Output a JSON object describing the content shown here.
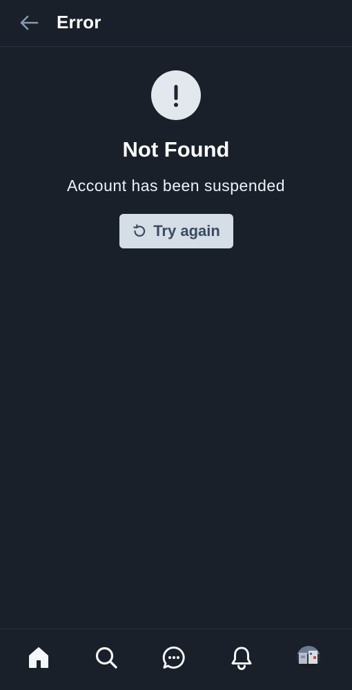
{
  "header": {
    "title": "Error",
    "back_icon": "arrow-left-icon"
  },
  "error": {
    "icon": "exclamation-icon",
    "title": "Not Found",
    "message": "Account has been suspended",
    "retry_label": "Try again",
    "retry_icon": "refresh-icon"
  },
  "bottom_nav": {
    "items": [
      {
        "name": "home",
        "icon": "home-icon",
        "active": true
      },
      {
        "name": "search",
        "icon": "search-icon",
        "active": false
      },
      {
        "name": "messages",
        "icon": "chat-icon",
        "active": false
      },
      {
        "name": "notifications",
        "icon": "bell-icon",
        "active": false
      },
      {
        "name": "profile",
        "icon": "avatar",
        "active": false
      }
    ]
  },
  "colors": {
    "background": "#19202a",
    "divider": "#273241",
    "icon_circle": "#e3e8ef",
    "button_bg": "#d5dde7",
    "button_text": "#3b4a5f",
    "text_primary": "#ffffff"
  }
}
